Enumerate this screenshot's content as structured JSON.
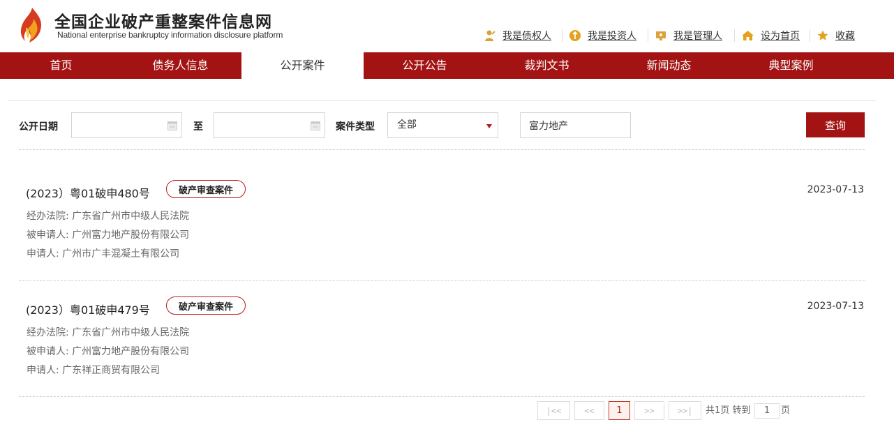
{
  "header": {
    "title": "全国企业破产重整案件信息网",
    "subtitle": "National enterprise bankruptcy  information disclosure platform",
    "links": [
      {
        "label": "我是债权人",
        "icon": "creditor-icon"
      },
      {
        "label": "我是投资人",
        "icon": "investor-icon"
      },
      {
        "label": "我是管理人",
        "icon": "manager-icon"
      },
      {
        "label": "设为首页",
        "icon": "home-icon"
      },
      {
        "label": "收藏",
        "icon": "star-icon"
      }
    ]
  },
  "nav": {
    "items": [
      "首页",
      "债务人信息",
      "公开案件",
      "公开公告",
      "裁判文书",
      "新闻动态",
      "典型案例"
    ],
    "active_index": 2
  },
  "search": {
    "date_label": "公开日期",
    "to_label": "至",
    "type_label": "案件类型",
    "type_value": "全部",
    "keyword_value": "富力地产",
    "query_label": "查询"
  },
  "cases": [
    {
      "title": "(2023）粤01破申480号",
      "tag": "破产审查案件",
      "date": "2023-07-13",
      "court": "经办法院: 广东省广州市中级人民法院",
      "respondent": "被申请人: 广州富力地产股份有限公司",
      "applicant": "申请人: 广州市广丰混凝土有限公司"
    },
    {
      "title": "(2023）粤01破申479号",
      "tag": "破产审查案件",
      "date": "2023-07-13",
      "court": "经办法院: 广东省广州市中级人民法院",
      "respondent": "被申请人: 广州富力地产股份有限公司",
      "applicant": "申请人: 广东祥正商贸有限公司"
    }
  ],
  "pagination": {
    "first": "|<<",
    "prev": "<<",
    "current": "1",
    "next": ">>",
    "last": ">>|",
    "total_text": "共1页 转到",
    "goto_value": "1",
    "page_suffix": "页"
  },
  "colors": {
    "brand_red": "#a31313",
    "tag_border": "#b31b1b"
  }
}
